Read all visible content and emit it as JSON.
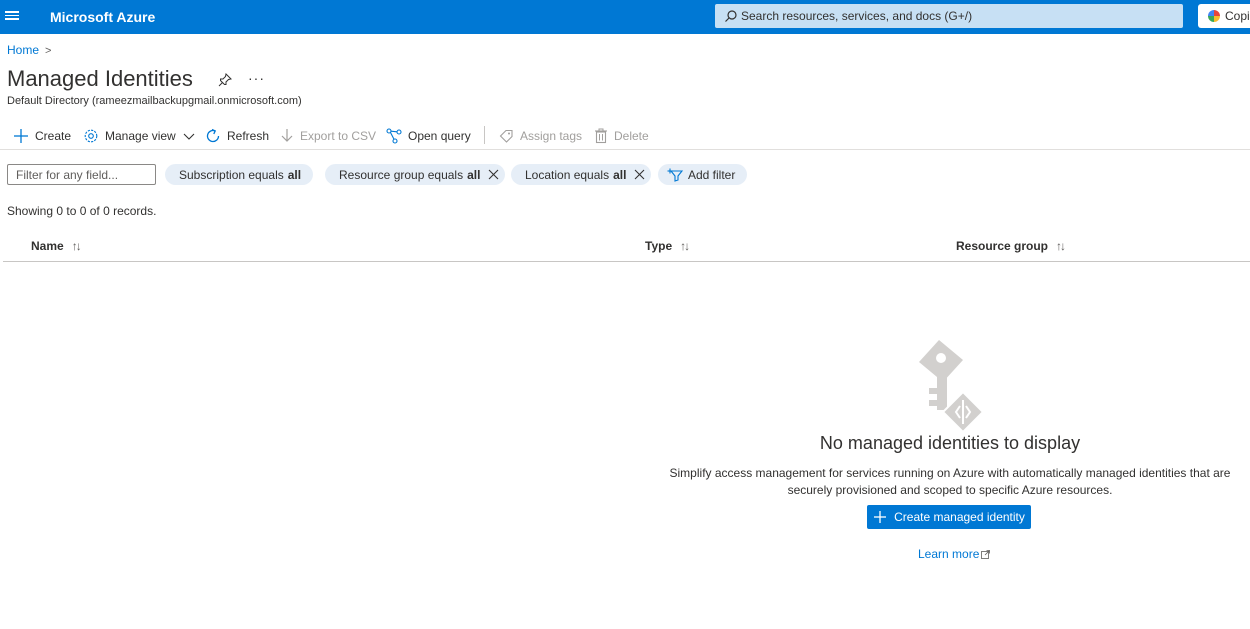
{
  "topbar": {
    "brand": "Microsoft Azure",
    "search_placeholder": "Search resources, services, and docs (G+/)",
    "copilot_label": "Copilot"
  },
  "breadcrumb": {
    "home": "Home"
  },
  "page": {
    "title": "Managed Identities",
    "subtitle": "Default Directory (rameezmailbackupgmail.onmicrosoft.com)",
    "more": "···"
  },
  "toolbar": {
    "create": "Create",
    "manage_view": "Manage view",
    "refresh": "Refresh",
    "export_csv": "Export to CSV",
    "open_query": "Open query",
    "assign_tags": "Assign tags",
    "delete": "Delete"
  },
  "filters": {
    "placeholder": "Filter for any field...",
    "subscription": {
      "label": "Subscription equals",
      "value": "all"
    },
    "resource_group": {
      "label": "Resource group equals",
      "value": "all"
    },
    "location": {
      "label": "Location equals",
      "value": "all"
    },
    "add_filter": "Add filter"
  },
  "records_text": "Showing 0 to 0 of 0 records.",
  "table": {
    "columns": [
      "Name",
      "Type",
      "Resource group"
    ]
  },
  "empty_state": {
    "title": "No managed identities to display",
    "description": "Simplify access management for services running on Azure with automatically managed identities that are securely provisioned and scoped to specific Azure resources.",
    "button": "Create managed identity",
    "learn_more": "Learn more"
  },
  "colors": {
    "accent": "#0078d4",
    "pill_bg": "#e6eef7",
    "search_bg": "#c7e0f4"
  }
}
